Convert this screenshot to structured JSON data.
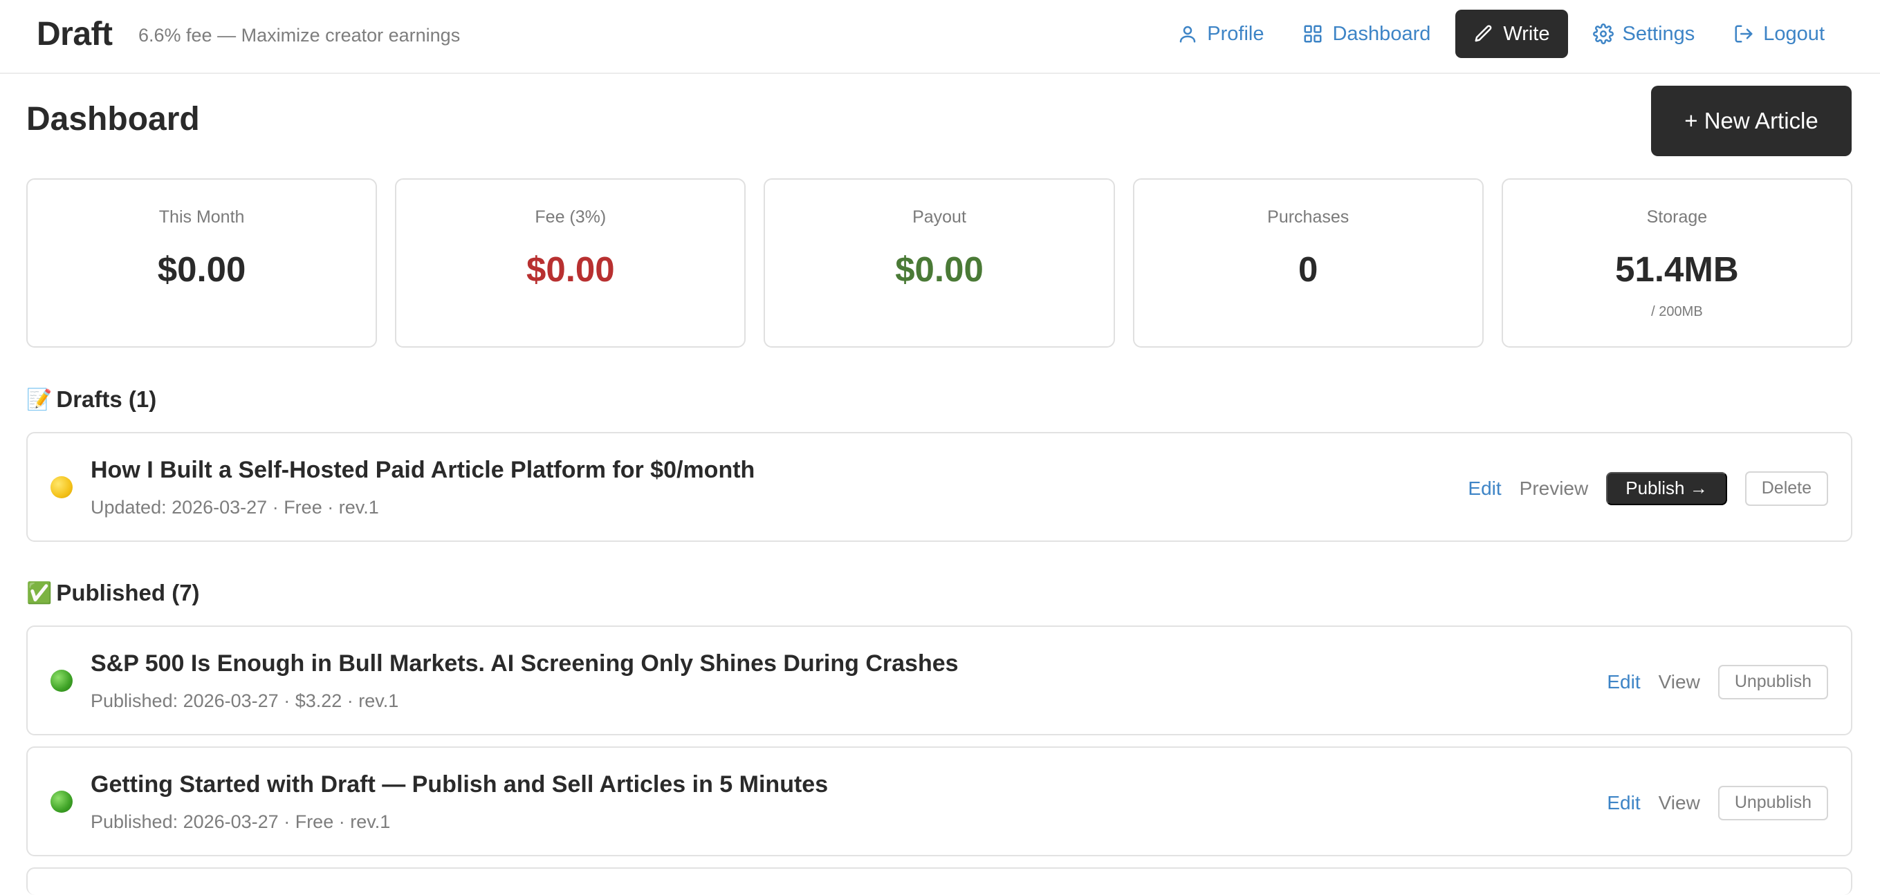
{
  "app": {
    "brand": "Draft",
    "tagline": "6.6% fee — Maximize creator earnings"
  },
  "nav": {
    "profile": "Profile",
    "dashboard": "Dashboard",
    "write": "Write",
    "settings": "Settings",
    "logout": "Logout"
  },
  "header": {
    "title": "Dashboard",
    "new_article": "+ New Article"
  },
  "stats": [
    {
      "label": "This Month",
      "value": "$0.00",
      "color": "#2a2a2a"
    },
    {
      "label": "Fee (3%)",
      "value": "$0.00",
      "color": "#b83030"
    },
    {
      "label": "Payout",
      "value": "$0.00",
      "color": "#4a7a36"
    },
    {
      "label": "Purchases",
      "value": "0",
      "color": "#2a2a2a"
    },
    {
      "label": "Storage",
      "value": "51.4MB",
      "sub": "/ 200MB",
      "color": "#2a2a2a"
    }
  ],
  "drafts": {
    "icon": "📝",
    "title": "Drafts (1)",
    "items": [
      {
        "status": "yellow-dot",
        "title": "How I Built a Self-Hosted Paid Article Platform for $0/month",
        "meta": "Updated: 2026-03-27 · Free · rev.1",
        "edit": "Edit",
        "preview": "Preview",
        "publish": "Publish →",
        "delete": "Delete"
      }
    ]
  },
  "published": {
    "icon": "✅",
    "title": "Published (7)",
    "items": [
      {
        "status": "green-dot",
        "title": "S&P 500 Is Enough in Bull Markets. AI Screening Only Shines During Crashes",
        "meta": "Published: 2026-03-27 · $3.22 · rev.1",
        "edit": "Edit",
        "view": "View",
        "unpublish": "Unpublish"
      },
      {
        "status": "green-dot",
        "title": "Getting Started with Draft — Publish and Sell Articles in 5 Minutes",
        "meta": "Published: 2026-03-27 · Free · rev.1",
        "edit": "Edit",
        "view": "View",
        "unpublish": "Unpublish"
      }
    ]
  },
  "colors": {
    "accent_blue": "#3d84c6",
    "dark": "#2c2c2c",
    "fee_red": "#b83030",
    "payout_green": "#4a7a36"
  }
}
